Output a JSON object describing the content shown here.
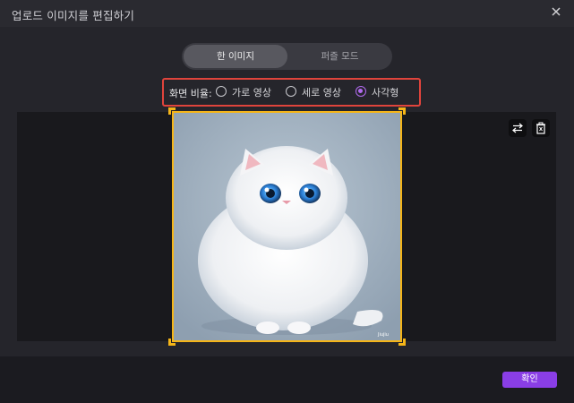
{
  "dialog": {
    "title": "업로드 이미지를 편집하기"
  },
  "mode_tabs": [
    {
      "label": "한 이미지",
      "active": true
    },
    {
      "label": "퍼즐 모드",
      "active": false
    }
  ],
  "aspect": {
    "label": "화면 비율:",
    "options": [
      {
        "label": "가로 영상",
        "checked": false
      },
      {
        "label": "세로 영상",
        "checked": false
      },
      {
        "label": "사각형",
        "checked": true
      }
    ]
  },
  "preview": {
    "watermark": "Jiujiu"
  },
  "footer": {
    "confirm_label": "확인"
  },
  "colors": {
    "accent": "#8a3ee6",
    "radio_checked": "#b26bf0",
    "crop_frame": "#f5b518",
    "highlight_box": "#e0443c"
  }
}
